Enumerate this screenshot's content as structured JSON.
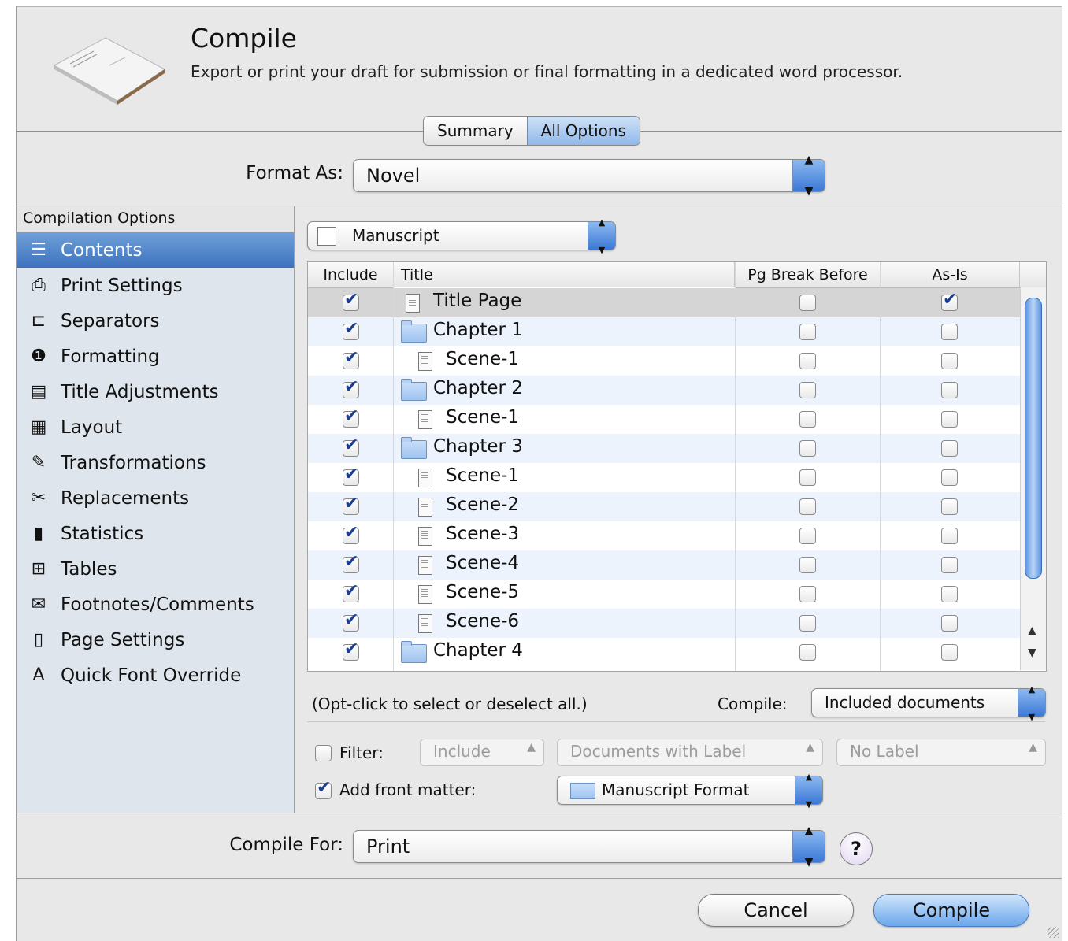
{
  "window": {
    "title": "Compile",
    "subtitle": "Export or print your draft for submission or final formatting in a dedicated word processor."
  },
  "tabs": {
    "summary": "Summary",
    "all_options": "All Options",
    "selected": "All Options"
  },
  "format_as": {
    "label": "Format As:",
    "value": "Novel"
  },
  "sidebar": {
    "header": "Compilation Options",
    "items": [
      {
        "label": "Contents",
        "icon": "contents-icon",
        "selected": true
      },
      {
        "label": "Print Settings",
        "icon": "printer-icon"
      },
      {
        "label": "Separators",
        "icon": "separators-icon"
      },
      {
        "label": "Formatting",
        "icon": "formatting-icon"
      },
      {
        "label": "Title Adjustments",
        "icon": "title-adjustments-icon"
      },
      {
        "label": "Layout",
        "icon": "layout-icon"
      },
      {
        "label": "Transformations",
        "icon": "transformations-icon"
      },
      {
        "label": "Replacements",
        "icon": "replacements-icon"
      },
      {
        "label": "Statistics",
        "icon": "statistics-icon"
      },
      {
        "label": "Tables",
        "icon": "tables-icon"
      },
      {
        "label": "Footnotes/Comments",
        "icon": "footnotes-icon"
      },
      {
        "label": "Page Settings",
        "icon": "page-settings-icon"
      },
      {
        "label": "Quick Font Override",
        "icon": "font-override-icon"
      }
    ]
  },
  "contents": {
    "source_popup": "Manuscript",
    "columns": {
      "include": "Include",
      "title": "Title",
      "pg_break": "Pg Break Before",
      "as_is": "As-Is"
    },
    "rows": [
      {
        "title": "Title Page",
        "type": "doc",
        "indent": 0,
        "include": true,
        "pg_break": false,
        "as_is": true
      },
      {
        "title": "Chapter 1",
        "type": "folder",
        "indent": 0,
        "include": true,
        "pg_break": false,
        "as_is": false
      },
      {
        "title": "Scene-1",
        "type": "doc",
        "indent": 1,
        "include": true,
        "pg_break": false,
        "as_is": false
      },
      {
        "title": "Chapter 2",
        "type": "folder",
        "indent": 0,
        "include": true,
        "pg_break": false,
        "as_is": false
      },
      {
        "title": "Scene-1",
        "type": "doc",
        "indent": 1,
        "include": true,
        "pg_break": false,
        "as_is": false
      },
      {
        "title": "Chapter 3",
        "type": "folder",
        "indent": 0,
        "include": true,
        "pg_break": false,
        "as_is": false
      },
      {
        "title": "Scene-1",
        "type": "doc",
        "indent": 1,
        "include": true,
        "pg_break": false,
        "as_is": false
      },
      {
        "title": "Scene-2",
        "type": "doc",
        "indent": 1,
        "include": true,
        "pg_break": false,
        "as_is": false
      },
      {
        "title": "Scene-3",
        "type": "doc",
        "indent": 1,
        "include": true,
        "pg_break": false,
        "as_is": false
      },
      {
        "title": "Scene-4",
        "type": "doc",
        "indent": 1,
        "include": true,
        "pg_break": false,
        "as_is": false
      },
      {
        "title": "Scene-5",
        "type": "doc",
        "indent": 1,
        "include": true,
        "pg_break": false,
        "as_is": false
      },
      {
        "title": "Scene-6",
        "type": "doc",
        "indent": 1,
        "include": true,
        "pg_break": false,
        "as_is": false
      },
      {
        "title": "Chapter 4",
        "type": "folder",
        "indent": 0,
        "include": true,
        "pg_break": false,
        "as_is": false
      }
    ],
    "hint": "(Opt-click to select or deselect all.)",
    "compile_label": "Compile:",
    "compile_value": "Included documents",
    "filter": {
      "checked": false,
      "label": "Filter:",
      "op": "Include",
      "field": "Documents with Label",
      "value": "No Label"
    },
    "front_matter": {
      "checked": true,
      "label": "Add front matter:",
      "value": "Manuscript Format"
    }
  },
  "compile_for": {
    "label": "Compile For:",
    "value": "Print"
  },
  "help": "?",
  "buttons": {
    "cancel": "Cancel",
    "compile": "Compile"
  },
  "colors": {
    "selection": "#3d72bf",
    "accent": "#6aa7ec"
  }
}
